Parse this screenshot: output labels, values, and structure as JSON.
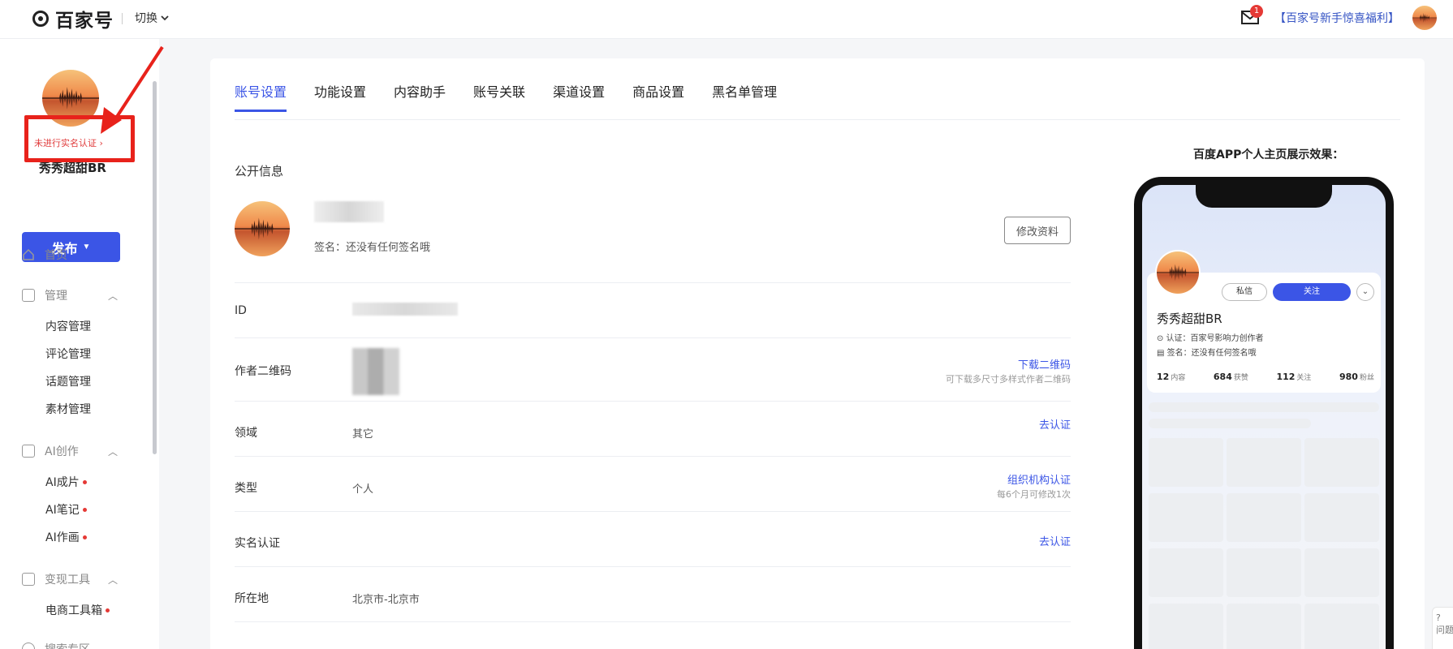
{
  "header": {
    "logo_text": "百家号",
    "switch_label": "切换",
    "mail_badge": "1",
    "promo_link": "【百家号新手惊喜福利】"
  },
  "sidebar": {
    "verify_status": "未进行实名认证 ›",
    "nickname": "秀秀超甜BR",
    "publish_label": "发布",
    "home": "首页",
    "manage": {
      "label": "管理",
      "items": [
        "内容管理",
        "评论管理",
        "话题管理",
        "素材管理"
      ]
    },
    "ai": {
      "label": "AI创作",
      "items": [
        "AI成片",
        "AI笔记",
        "AI作画"
      ]
    },
    "monetize": {
      "label": "变现工具",
      "items": [
        "电商工具箱"
      ]
    },
    "more": "搜索专区"
  },
  "tabs": [
    "账号设置",
    "功能设置",
    "内容助手",
    "账号关联",
    "渠道设置",
    "商品设置",
    "黑名单管理"
  ],
  "public_info": {
    "section_title": "公开信息",
    "signature": "签名：还没有任何签名哦",
    "edit_button": "修改资料"
  },
  "rows": {
    "id": {
      "label": "ID"
    },
    "qrcode": {
      "label": "作者二维码",
      "link": "下载二维码",
      "sub": "可下载多尺寸多样式作者二维码"
    },
    "field": {
      "label": "领域",
      "value": "其它",
      "link": "去认证"
    },
    "type": {
      "label": "类型",
      "value": "个人",
      "link": "组织机构认证",
      "sub": "每6个月可修改1次"
    },
    "realname": {
      "label": "实名认证",
      "link": "去认证"
    },
    "location": {
      "label": "所在地",
      "value": "北京市-北京市"
    }
  },
  "preview": {
    "title": "百度APP个人主页展示效果：",
    "msg_button": "私信",
    "follow_button": "关注",
    "name": "秀秀超甜BR",
    "cert": "认证：百家号影响力创作者",
    "signature": "签名：还没有任何签名哦",
    "stats": [
      {
        "num": "12",
        "label": "内容"
      },
      {
        "num": "684",
        "label": "获赞"
      },
      {
        "num": "112",
        "label": "关注"
      },
      {
        "num": "980",
        "label": "粉丝"
      }
    ]
  },
  "helper_label": "问题",
  "colors": {
    "accent": "#3b55e6",
    "alert": "#e8221b",
    "badge": "#e53935"
  }
}
